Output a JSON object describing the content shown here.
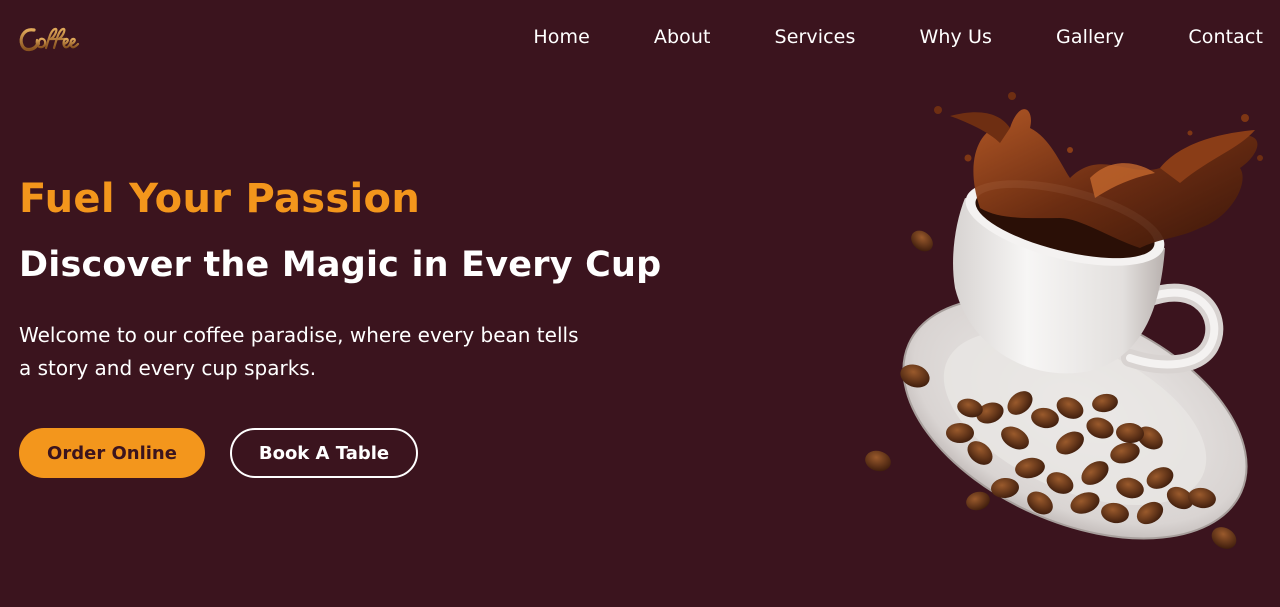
{
  "brand": {
    "logo_text": "Coffee",
    "logo_color": "#c58a3e"
  },
  "nav": {
    "items": [
      {
        "label": "Home"
      },
      {
        "label": "About"
      },
      {
        "label": "Services"
      },
      {
        "label": "Why Us"
      },
      {
        "label": "Gallery"
      },
      {
        "label": "Contact"
      }
    ]
  },
  "hero": {
    "kicker": "Fuel Your Passion",
    "title": "Discover the Magic in Every Cup",
    "description": "Welcome to our coffee paradise, where every bean tells a story and every cup sparks.",
    "buttons": {
      "order": "Order Online",
      "book": "Book A Table"
    },
    "image_alt": "coffee-cup-splash-icon"
  },
  "colors": {
    "background": "#3b141e",
    "accent": "#f3961c",
    "text": "#ffffff"
  }
}
